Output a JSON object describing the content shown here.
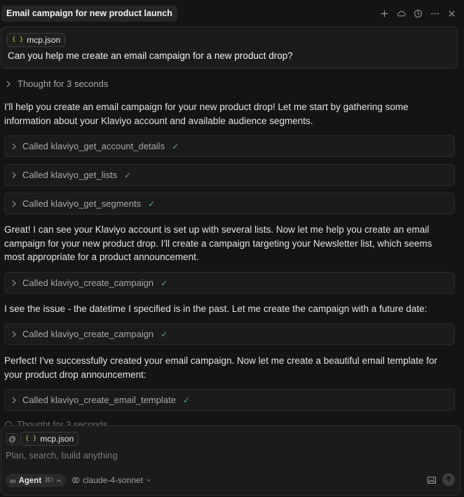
{
  "header": {
    "title": "Email campaign for new product launch",
    "icons": [
      "plus-icon",
      "cloud-icon",
      "history-icon",
      "more-icon",
      "close-icon"
    ]
  },
  "user_message": {
    "attachment": "mcp.json",
    "text": "Can you help me create an email campaign for a new product drop?"
  },
  "thought": "Thought for 3 seconds",
  "paragraphs": [
    "I'll help you create an email campaign for your new product drop! Let me start by gathering some information about your Klaviyo account and available audience segments.",
    "Great! I can see your Klaviyo account is set up with several lists. Now let me help you create an email campaign for your new product drop. I'll create a campaign targeting your Newsletter list, which seems most appropriate for a product announcement.",
    "I see the issue - the datetime I specified is in the past. Let me create the campaign with a future date:",
    "Perfect! I've successfully created your email campaign. Now let me create a beautiful email template for your product drop announcement:"
  ],
  "tools": [
    "Called klaviyo_get_account_details",
    "Called klaviyo_get_lists",
    "Called klaviyo_get_segments",
    "Called klaviyo_create_campaign",
    "Called klaviyo_create_campaign",
    "Called klaviyo_create_email_template"
  ],
  "fading_thought": "Thought for 3 seconds",
  "composer": {
    "at_symbol": "@",
    "attachment": "mcp.json",
    "placeholder": "Plan, search, build anything",
    "mode_label": "Agent",
    "mode_shortcut": "⌘I",
    "model": "claude-4-sonnet"
  },
  "colors": {
    "background": "#141414",
    "card": "#1b1b1b",
    "check": "#5fa876",
    "json_brace": "#d4c05a"
  }
}
